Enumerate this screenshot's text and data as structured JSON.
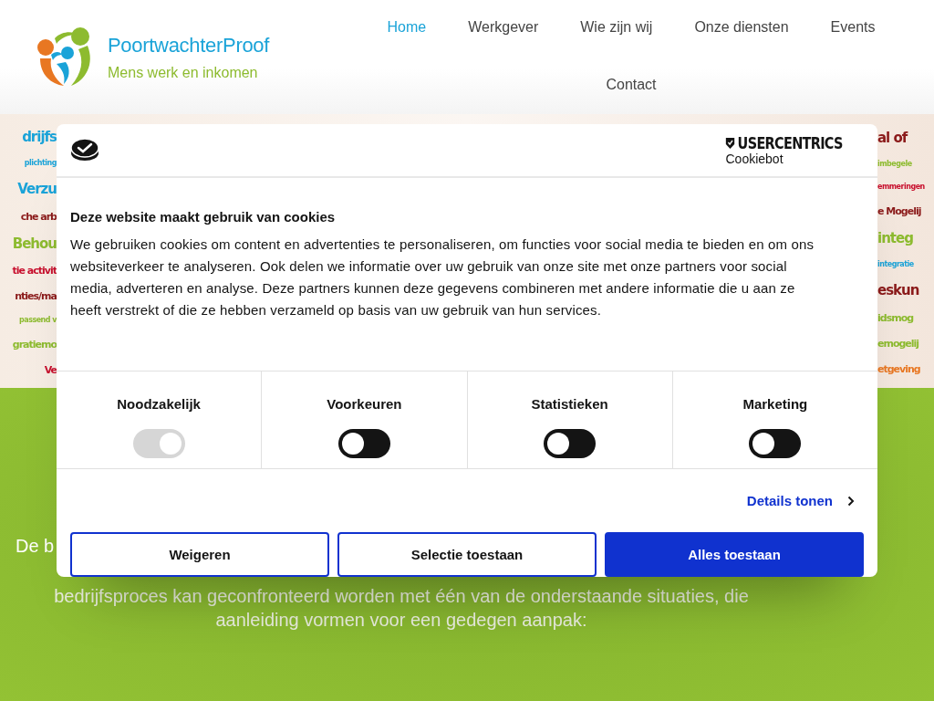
{
  "header": {
    "brand": "PoortwachterProof",
    "tagline": "Mens werk en inkomen",
    "nav": [
      {
        "label": "Home",
        "selected": true
      },
      {
        "label": "Werkgever",
        "selected": false
      },
      {
        "label": "Wie zijn wij",
        "selected": false
      },
      {
        "label": "Onze diensten",
        "selected": false
      },
      {
        "label": "Events",
        "selected": false
      },
      {
        "label": "Contact",
        "selected": false
      }
    ]
  },
  "banner": {
    "left_words": [
      {
        "text": "drijfs",
        "kind": "big",
        "color": "#1aa3d8"
      },
      {
        "text": "plichting",
        "kind": "small",
        "color": "#1aa3d8"
      },
      {
        "text": "Verzu",
        "kind": "big",
        "color": "#1aa3d8"
      },
      {
        "text": "che arb",
        "kind": "medium",
        "color": "#8b1a1a"
      },
      {
        "text": "Behou",
        "kind": "big",
        "color": "#8dbb2f"
      },
      {
        "text": "tie activit",
        "kind": "medium",
        "color": "#c8102e"
      },
      {
        "text": "nties/ma",
        "kind": "medium",
        "color": "#8b1a1a"
      },
      {
        "text": "passend v",
        "kind": "small",
        "color": "#8dbb2f"
      },
      {
        "text": "gratiemo",
        "kind": "medium",
        "color": "#8dbb2f"
      },
      {
        "text": "Ve",
        "kind": "medium",
        "color": "#c8102e"
      }
    ],
    "right_words": [
      {
        "text": "al of",
        "kind": "big",
        "color": "#8b1a1a"
      },
      {
        "text": "imbegele",
        "kind": "small",
        "color": "#8dbb2f"
      },
      {
        "text": "emmeringen",
        "kind": "small",
        "color": "#c8102e"
      },
      {
        "text": "e Mogelij",
        "kind": "medium",
        "color": "#8b1a1a"
      },
      {
        "text": "integ",
        "kind": "big",
        "color": "#8dbb2f"
      },
      {
        "text": "integratie",
        "kind": "small",
        "color": "#1aa3d8"
      },
      {
        "text": "eskun",
        "kind": "big",
        "color": "#8b1a1a"
      },
      {
        "text": "idsmog",
        "kind": "medium",
        "color": "#8dbb2f"
      },
      {
        "text": "emogelij",
        "kind": "medium",
        "color": "#8dbb2f"
      },
      {
        "text": "etgeving",
        "kind": "medium",
        "color": "#e87722"
      }
    ]
  },
  "intro": {
    "visible_start": "De b",
    "lines": [
      "bedrijfsproces kan geconfronteerd worden met één van de onderstaande situaties, die",
      "aanleiding vormen voor een gedegen aanpak:"
    ]
  },
  "cookie_dialog": {
    "provider": "USERCENTRICS",
    "provider_product": "Cookiebot",
    "title": "Deze website maakt gebruik van cookies",
    "text": "We gebruiken cookies om content en advertenties te personaliseren, om functies voor social media te bieden en om ons websiteverkeer te analyseren. Ook delen we informatie over uw gebruik van onze site met onze partners voor social media, adverteren en analyse. Deze partners kunnen deze gegevens combineren met andere informatie die u aan ze heeft verstrekt of die ze hebben verzameld op basis van uw gebruik van hun services.",
    "categories": [
      {
        "label": "Noodzakelijk",
        "on": true,
        "disabled": true
      },
      {
        "label": "Voorkeuren",
        "on": false,
        "disabled": false
      },
      {
        "label": "Statistieken",
        "on": false,
        "disabled": false
      },
      {
        "label": "Marketing",
        "on": false,
        "disabled": false
      }
    ],
    "details_link": "Details tonen",
    "buttons": [
      {
        "label": "Weigeren",
        "kind": "outline"
      },
      {
        "label": "Selectie toestaan",
        "kind": "outline"
      },
      {
        "label": "Alles toestaan",
        "kind": "primary"
      }
    ]
  }
}
